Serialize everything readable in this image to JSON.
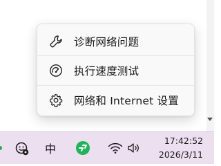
{
  "menu": {
    "items": [
      {
        "label": "诊断网络问题",
        "icon": "wrench-icon"
      },
      {
        "label": "执行速度测试",
        "icon": "speedometer-icon"
      },
      {
        "label": "网络和 Internet 设置",
        "icon": "gear-icon"
      }
    ]
  },
  "taskbar": {
    "input_method": "中",
    "time": "17:42:52",
    "date": "2026/3/11"
  },
  "colors": {
    "taskbar_bg": "#ecdff0",
    "menu_bg": "#f9f9f9",
    "app_icon_green": "#21b35a"
  }
}
